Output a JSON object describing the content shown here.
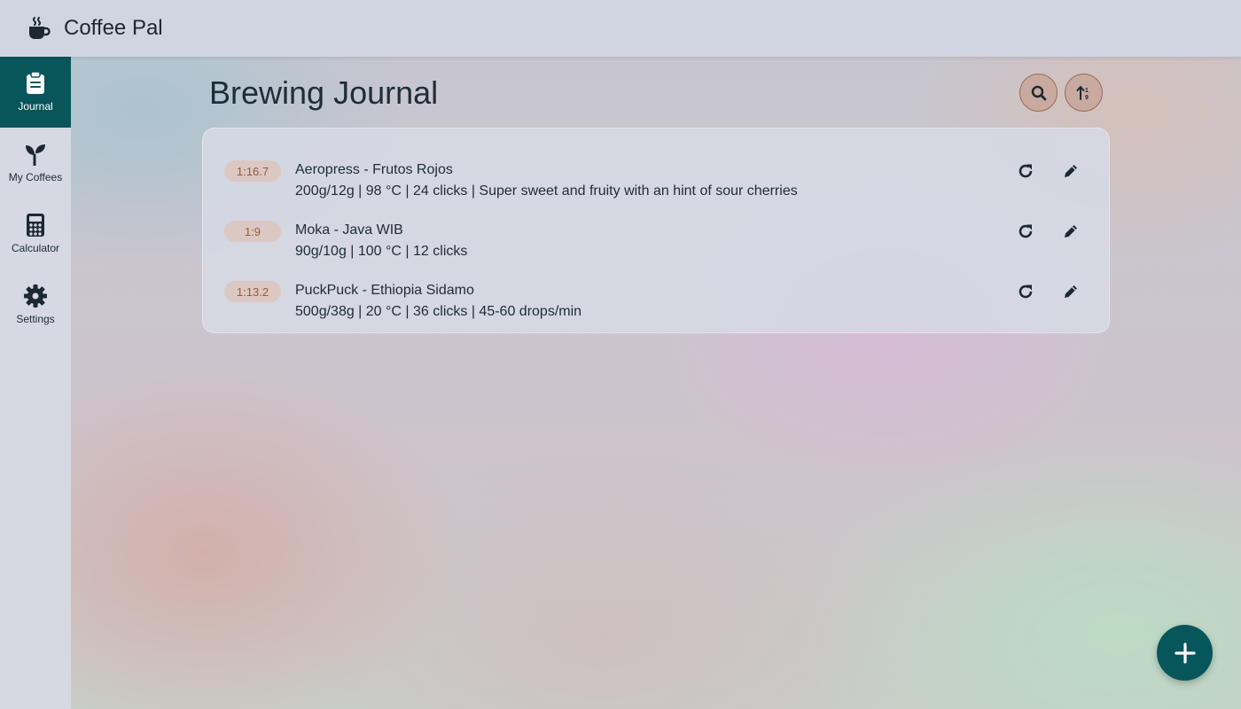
{
  "app": {
    "title": "Coffee Pal",
    "logo_icon": "coffee-cup-icon"
  },
  "sidebar": {
    "items": [
      {
        "label": "Journal",
        "icon": "clipboard-icon",
        "active": true
      },
      {
        "label": "My Coffees",
        "icon": "seedling-icon",
        "active": false
      },
      {
        "label": "Calculator",
        "icon": "calculator-icon",
        "active": false
      },
      {
        "label": "Settings",
        "icon": "gear-icon",
        "active": false
      }
    ]
  },
  "main": {
    "title": "Brewing Journal",
    "search_icon": "search-icon",
    "sort_icon": "sort-icon",
    "entries": [
      {
        "ratio": "1:16.7",
        "title": "Aeropress - Frutos Rojos",
        "details": "200g/12g | 98 °C | 24 clicks | Super sweet and fruity with an hint of sour cherries"
      },
      {
        "ratio": "1:9",
        "title": "Moka - Java WIB",
        "details": "90g/10g | 100 °C | 12 clicks"
      },
      {
        "ratio": "1:13.2",
        "title": "PuckPuck - Ethiopia Sidamo",
        "details": "500g/38g | 20 °C | 36 clicks | 45-60 drops/min"
      }
    ],
    "add_icon": "plus-icon"
  },
  "colors": {
    "accent": "#08565a",
    "ratio_badge_bg": "#dcc8c3",
    "ratio_badge_text": "#9a5a34",
    "tool_button_bg": "#c9aaa0"
  }
}
